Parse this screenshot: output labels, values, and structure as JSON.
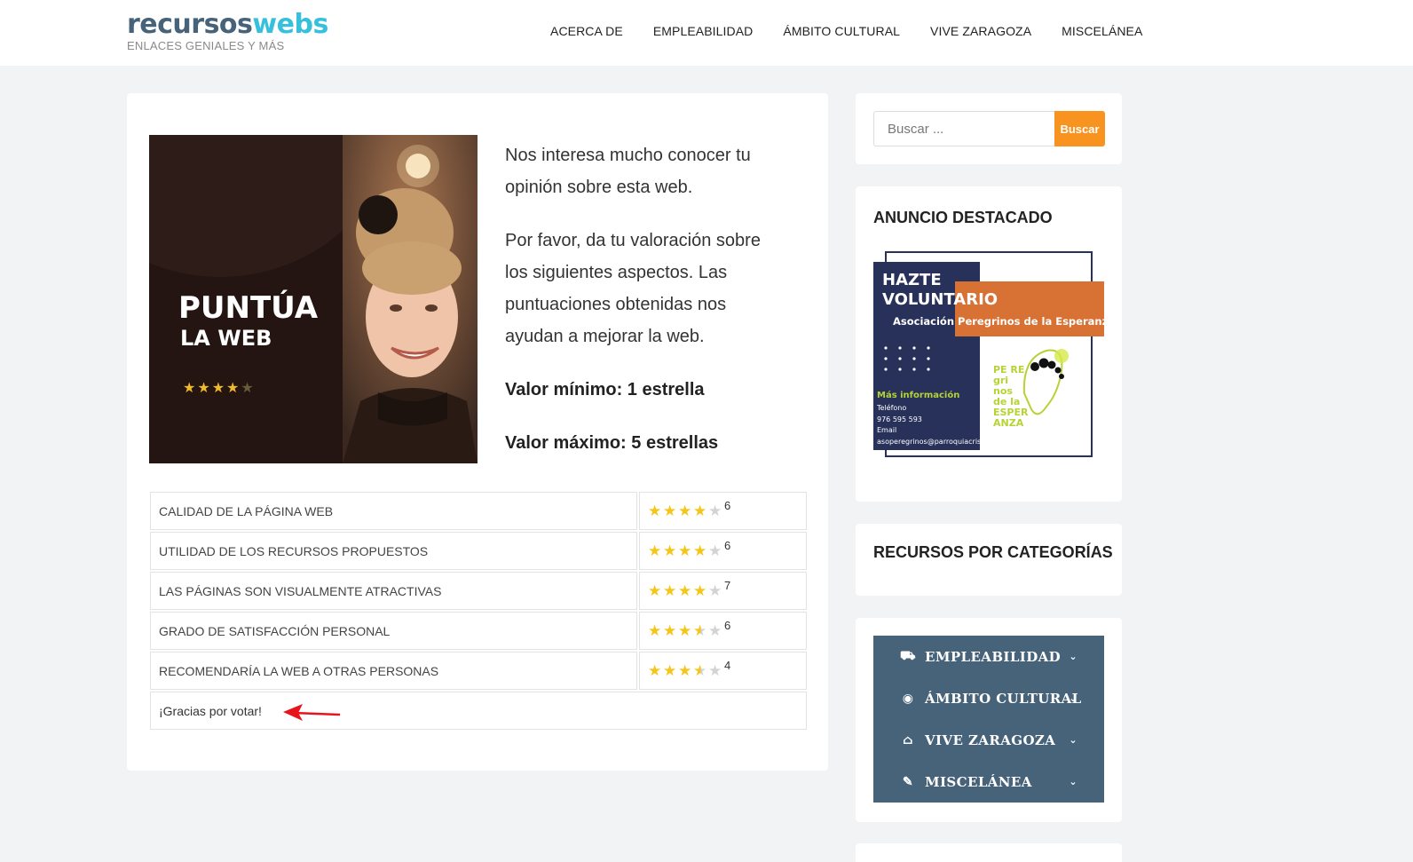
{
  "site": {
    "logo_part1": "recursos",
    "logo_part2": "webs",
    "tagline": "ENLACES GENIALES Y MÁS"
  },
  "nav": [
    "ACERCA DE",
    "EMPLEABILIDAD",
    "ÁMBITO CULTURAL",
    "VIVE ZARAGOZA",
    "MISCELÁNEA"
  ],
  "hero": {
    "title": "PUNTÚA",
    "subtitle": "LA WEB",
    "stars": "★★★★",
    "stars_dim": "★"
  },
  "intro": {
    "p1": "Nos interesa mucho conocer tu opinión sobre esta web.",
    "p2": "Por favor, da tu valoración sobre los siguientes aspectos. Las puntuaciones obtenidas nos ayudan a mejorar la web.",
    "min": "Valor mínimo: 1 estrella",
    "max": "Valor máximo: 5 estrellas"
  },
  "ratings": [
    {
      "label": "CALIDAD DE LA PÁGINA WEB",
      "rating": 4,
      "count": "6"
    },
    {
      "label": "UTILIDAD DE LOS RECURSOS PROPUESTOS",
      "rating": 4,
      "count": "6"
    },
    {
      "label": "LAS PÁGINAS SON VISUALMENTE ATRACTIVAS",
      "rating": 4,
      "count": "7"
    },
    {
      "label": "GRADO DE SATISFACCIÓN PERSONAL",
      "rating": 3.5,
      "count": "6"
    },
    {
      "label": "RECOMENDARÍA LA WEB A OTRAS PERSONAS",
      "rating": 3.5,
      "count": "4"
    }
  ],
  "thanks": "¡Gracias por votar!",
  "search": {
    "placeholder": "Buscar ...",
    "button": "Buscar"
  },
  "ad": {
    "title": "ANUNCIO DESTACADO",
    "headline1": "HAZTE",
    "headline2": "VOLUNTARIO",
    "org": "Asociación Peregrinos de la Esperanza",
    "more_info": "Más información",
    "phone_label": "Teléfono",
    "phone": "976 595 593",
    "email_label": "Email",
    "email": "asoperegrinos@parroquiacristorey.org",
    "logo_text": "PE RE gri nos de la ESPERANZA"
  },
  "categories_title": "RECURSOS POR CATEGORÍAS",
  "menu": [
    {
      "icon": "⛟",
      "label": "EMPLEABILIDAD"
    },
    {
      "icon": "◉",
      "label": "ÁMBITO CULTURAL"
    },
    {
      "icon": "⌂",
      "label": "VIVE ZARAGOZA"
    },
    {
      "icon": "✎",
      "label": "MISCELÁNEA"
    }
  ],
  "colors": {
    "brand_dark": "#46637a",
    "brand_light": "#36c0dc",
    "accent": "#f7931e",
    "star": "#f5c518"
  }
}
